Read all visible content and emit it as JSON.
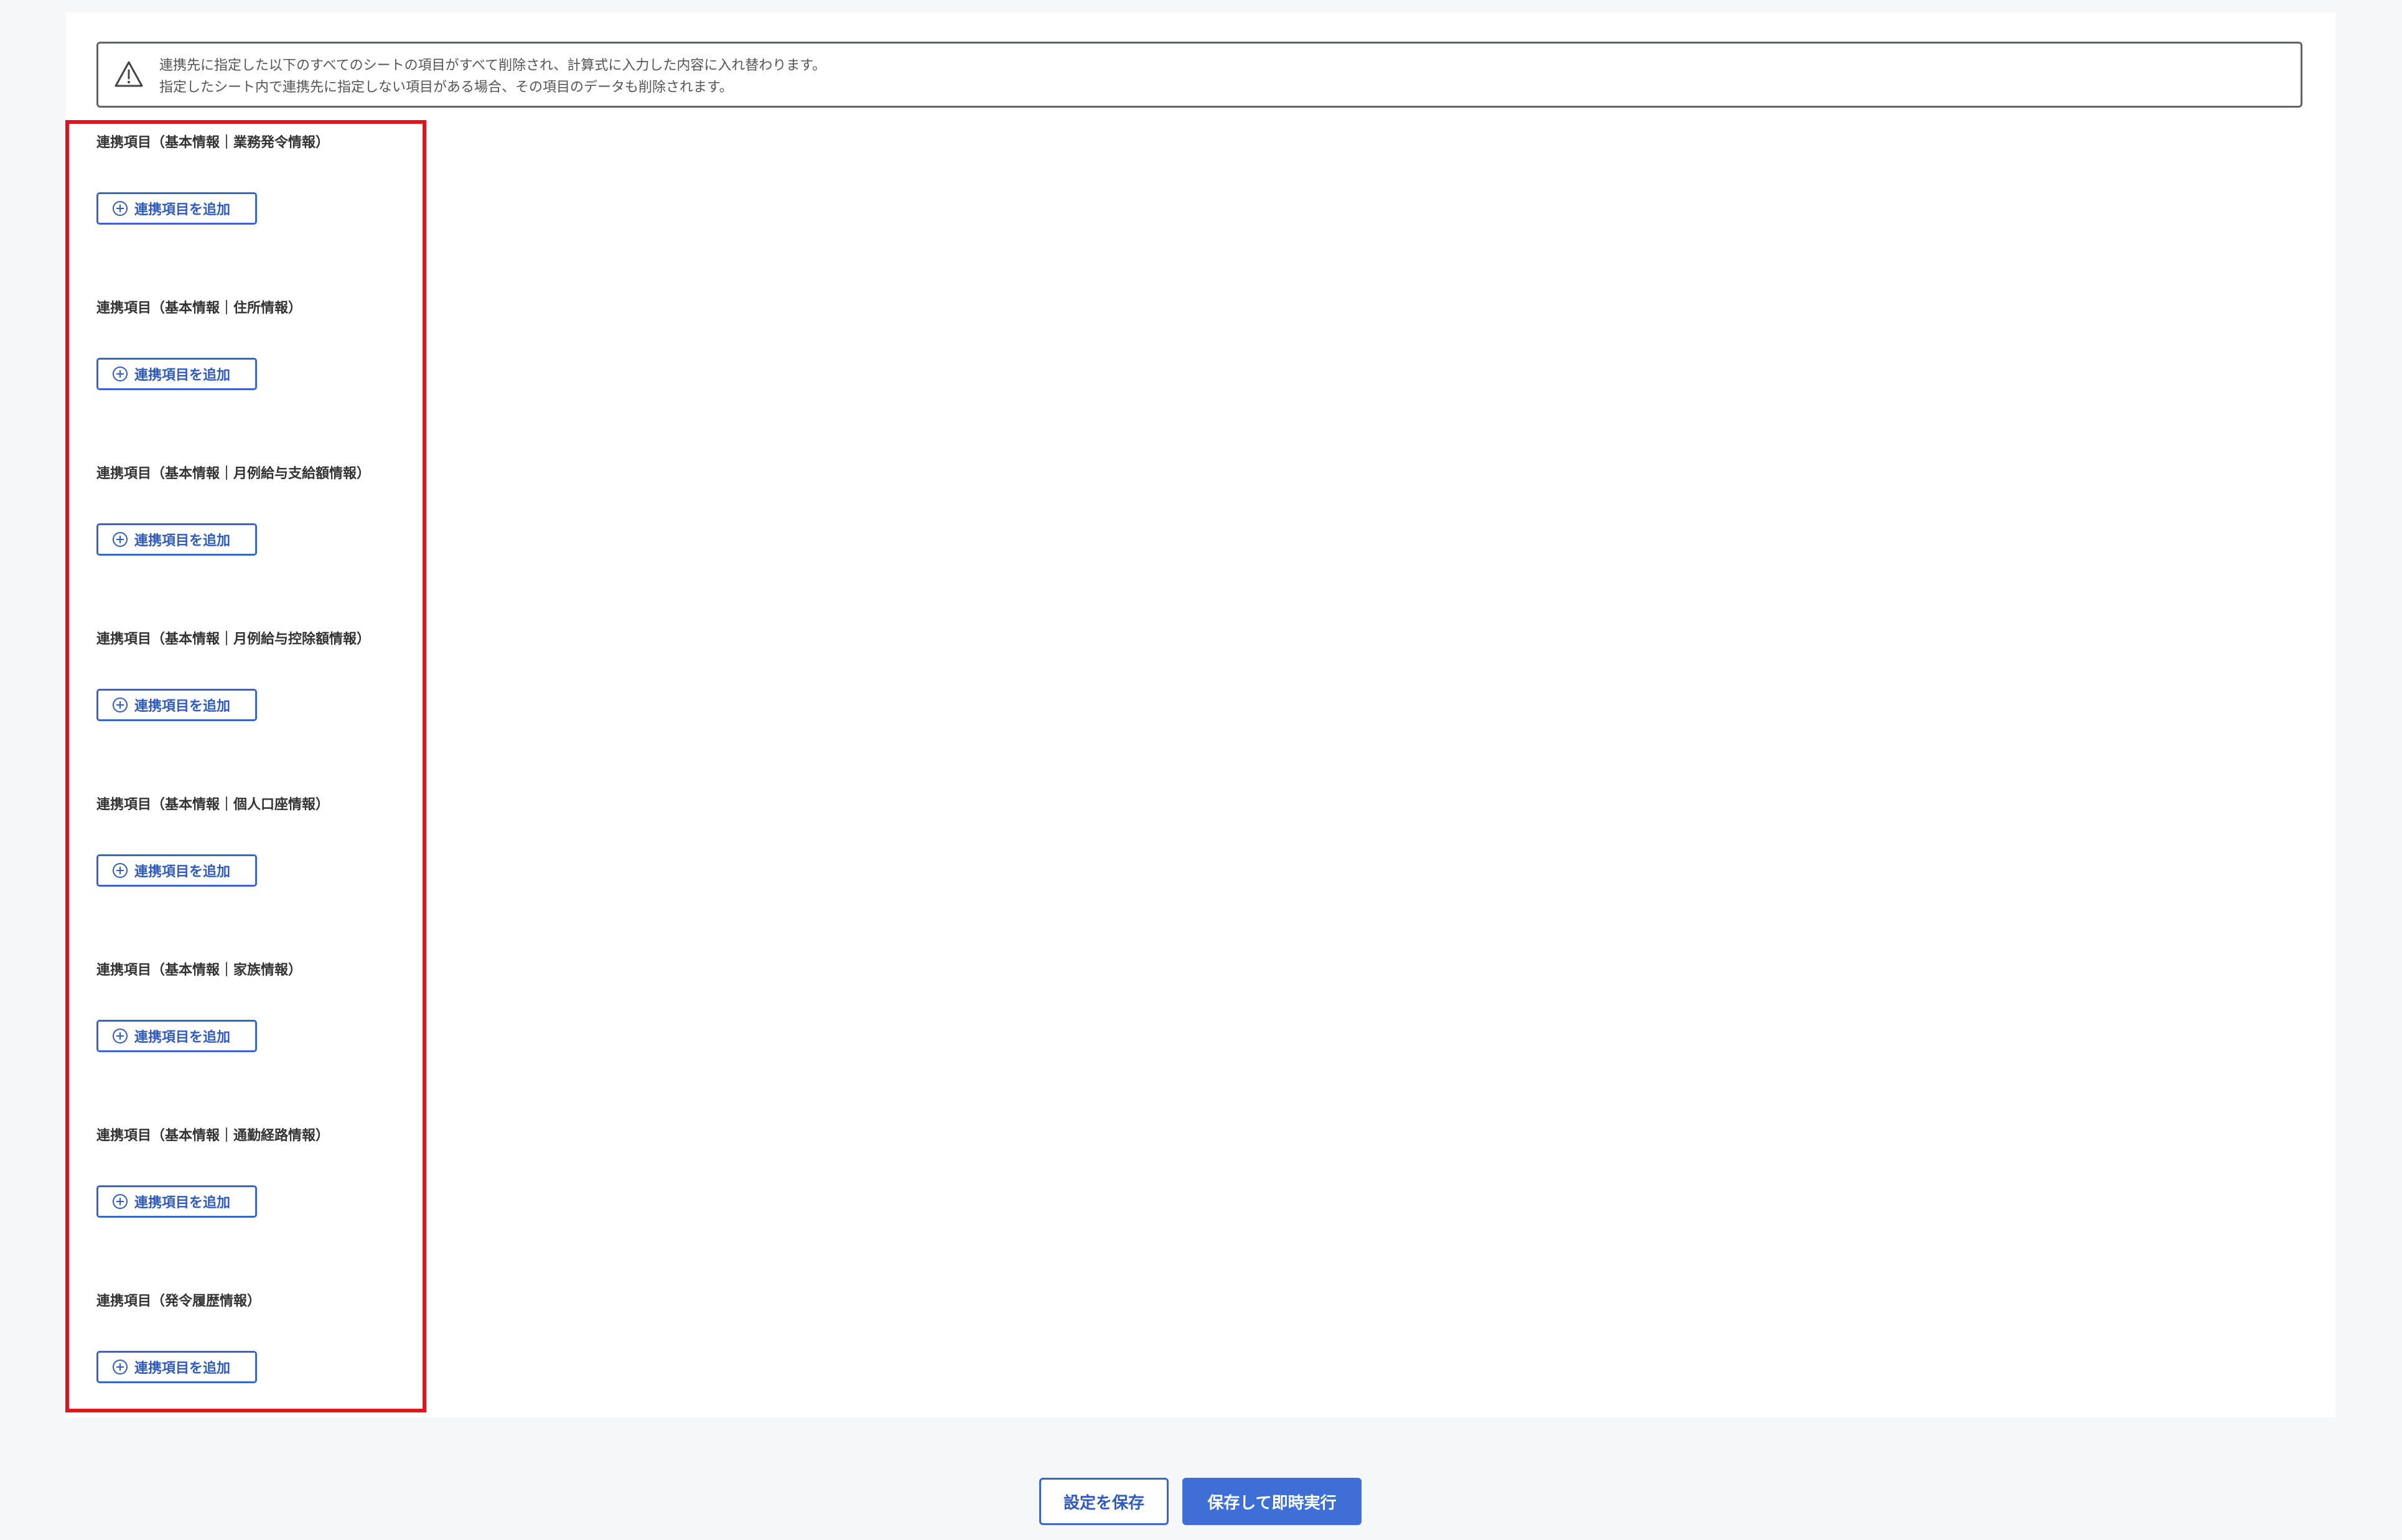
{
  "warning": {
    "lines": [
      "連携先に指定した以下のすべてのシートの項目がすべて削除され、計算式に入力した内容に入れ替わります。",
      "指定したシート内で連携先に指定しない項目がある場合、その項目のデータも削除されます。"
    ]
  },
  "sections": [
    {
      "title": "連携項目（基本情報｜業務発令情報）",
      "button_label": "連携項目を追加"
    },
    {
      "title": "連携項目（基本情報｜住所情報）",
      "button_label": "連携項目を追加"
    },
    {
      "title": "連携項目（基本情報｜月例給与支給額情報）",
      "button_label": "連携項目を追加"
    },
    {
      "title": "連携項目（基本情報｜月例給与控除額情報）",
      "button_label": "連携項目を追加"
    },
    {
      "title": "連携項目（基本情報｜個人口座情報）",
      "button_label": "連携項目を追加"
    },
    {
      "title": "連携項目（基本情報｜家族情報）",
      "button_label": "連携項目を追加"
    },
    {
      "title": "連携項目（基本情報｜通勤経路情報）",
      "button_label": "連携項目を追加"
    },
    {
      "title": "連携項目（発令履歴情報）",
      "button_label": "連携項目を追加"
    }
  ],
  "footer": {
    "save_label": "設定を保存",
    "save_execute_label": "保存して即時実行"
  },
  "colors": {
    "accent": "#3d6fd6",
    "highlight": "#e0141c"
  },
  "icons": {
    "warning": "warning-triangle-icon",
    "add": "plus-circle-icon"
  }
}
